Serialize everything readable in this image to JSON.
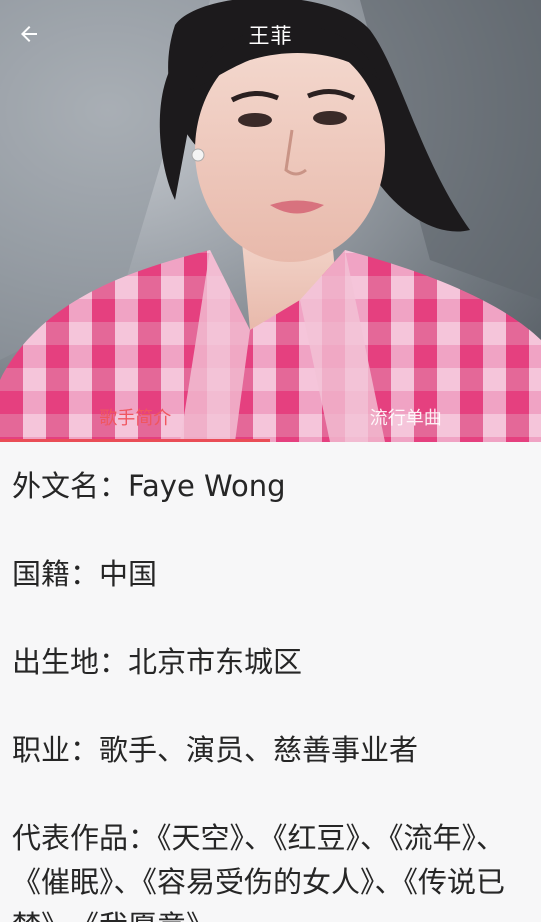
{
  "header": {
    "title": "王菲",
    "back_icon": "arrow-left-icon"
  },
  "tabs": [
    {
      "label": "歌手简介",
      "active": true
    },
    {
      "label": "流行单曲",
      "active": false
    }
  ],
  "colors": {
    "accent": "#ea4d57",
    "text": "#262626",
    "background": "#f7f7f8"
  },
  "bio": {
    "foreign_name": "外文名：Faye Wong",
    "nationality": "国籍：中国",
    "birthplace": "出生地：北京市东城区",
    "occupation": "职业：歌手、演员、慈善事业者",
    "works": "代表作品：《天空》、《红豆》、《流年》、《催眠》、《容易受伤的女人》、《传说已梦》、《我愿意》"
  }
}
